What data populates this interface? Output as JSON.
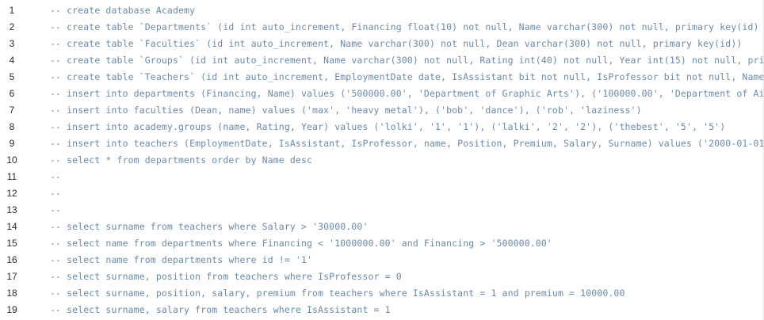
{
  "editor": {
    "lines": [
      {
        "num": "1",
        "text": "-- create database Academy"
      },
      {
        "num": "2",
        "text": "-- create table `Departments` (id int auto_increment, Financing float(10) not null, Name varchar(300) not null, primary key(id)"
      },
      {
        "num": "3",
        "text": "-- create table `Faculties` (id int auto_increment, Name varchar(300) not null, Dean varchar(300) not null, primary key(id))"
      },
      {
        "num": "4",
        "text": "-- create table `Groups` (id int auto_increment, Name varchar(300) not null, Rating int(40) not null, Year int(15) not null, pri"
      },
      {
        "num": "5",
        "text": "-- create table `Teachers` (id int auto_increment, EmploymentDate date, IsAssistant bit not null, IsProfessor bit not null, Name"
      },
      {
        "num": "6",
        "text": "-- insert into departments (Financing, Name) values ('500000.00', 'Department of Graphic Arts'), ('100000.00', 'Department of Ai"
      },
      {
        "num": "7",
        "text": "-- insert into faculties (Dean, name) values ('max', 'heavy metal'), ('bob', 'dance'), ('rob', 'laziness')"
      },
      {
        "num": "8",
        "text": "-- insert into academy.groups (name, Rating, Year) values ('lolki', '1', '1'), ('lalki', '2', '2'), ('thebest', '5', '5')"
      },
      {
        "num": "9",
        "text": "-- insert into teachers (EmploymentDate, IsAssistant, IsProfessor, name, Position, Premium, Salary, Surname) values ('2000-01-01"
      },
      {
        "num": "10",
        "text": "-- select * from departments order by Name desc"
      },
      {
        "num": "11",
        "text": "--"
      },
      {
        "num": "12",
        "text": "--"
      },
      {
        "num": "13",
        "text": "--"
      },
      {
        "num": "14",
        "text": "-- select surname from teachers where Salary > '30000.00'"
      },
      {
        "num": "15",
        "text": "-- select name from departments where Financing < '1000000.00' and Financing > '500000.00'"
      },
      {
        "num": "16",
        "text": "-- select name from departments where id != '1'"
      },
      {
        "num": "17",
        "text": "-- select surname, position from teachers where IsProfessor = 0"
      },
      {
        "num": "18",
        "text": "-- select surname, position, salary, premium from teachers where IsAssistant = 1 and premium = 10000.00"
      },
      {
        "num": "19",
        "text": "-- select surname, salary from teachers where IsAssistant = 1"
      }
    ]
  }
}
